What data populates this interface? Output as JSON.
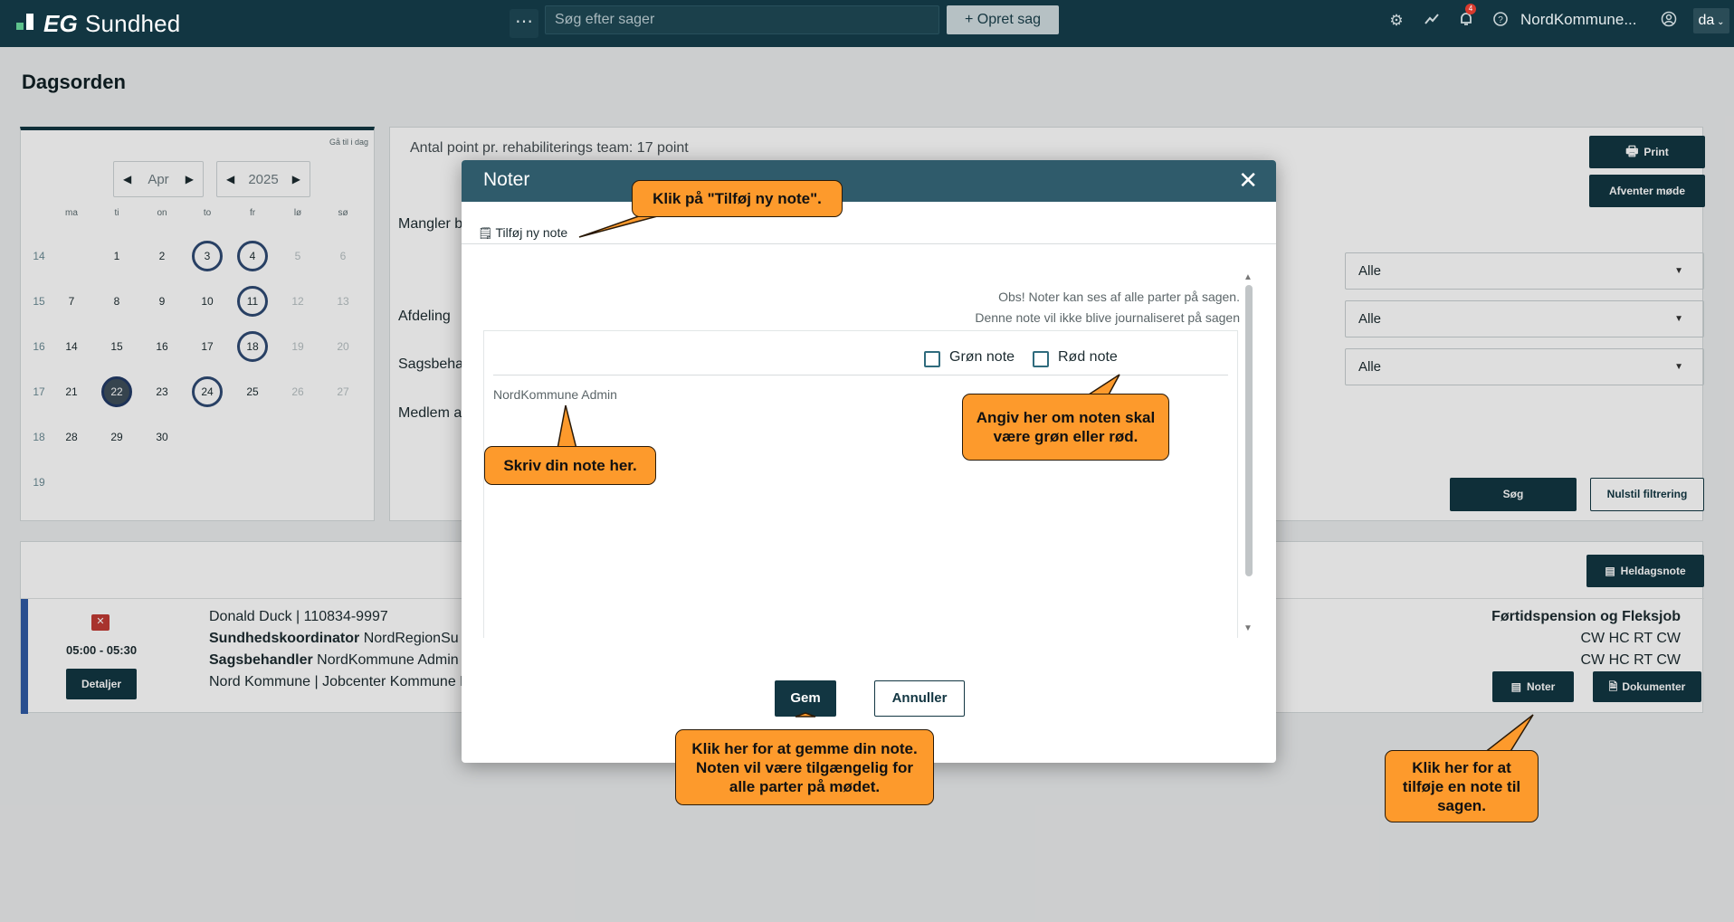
{
  "header": {
    "logo_bold": "EG",
    "logo_text": "Sundhed",
    "search_placeholder": "Søg efter sager",
    "create_label": "+ Opret sag",
    "notif_count": "4",
    "org_name": "NordKommune...",
    "lang": "da"
  },
  "page": {
    "title": "Dagsorden"
  },
  "calendar": {
    "goto_today": "Gå til i dag",
    "month": "Apr",
    "year": "2025",
    "weekdays": [
      "ma",
      "ti",
      "on",
      "to",
      "fr",
      "lø",
      "sø"
    ],
    "weeks": [
      {
        "wk": "14",
        "days": [
          "",
          "1",
          "2",
          "3",
          "4",
          "5",
          "6"
        ]
      },
      {
        "wk": "15",
        "days": [
          "7",
          "8",
          "9",
          "10",
          "11",
          "12",
          "13"
        ]
      },
      {
        "wk": "16",
        "days": [
          "14",
          "15",
          "16",
          "17",
          "18",
          "19",
          "20"
        ]
      },
      {
        "wk": "17",
        "days": [
          "21",
          "22",
          "23",
          "24",
          "25",
          "26",
          "27"
        ]
      },
      {
        "wk": "18",
        "days": [
          "28",
          "29",
          "30",
          "",
          "",
          "",
          ""
        ]
      },
      {
        "wk": "19",
        "days": [
          "",
          "",
          "",
          "",
          "",
          "",
          ""
        ]
      }
    ],
    "ringed": [
      "3",
      "4",
      "11",
      "18",
      "24"
    ],
    "today": "22"
  },
  "filters": {
    "points_text": "Antal point pr. rehabiliterings team: 17 point",
    "label_missing": "Mangler b",
    "label_department": "Afdeling",
    "label_caseworker": "Sagsbeha",
    "label_member": "Medlem a",
    "select_1": "Alle",
    "select_2": "Alle",
    "select_3": "Alle",
    "print_label": "Print",
    "await_label": "Afventer møde",
    "search_label": "Søg",
    "reset_label": "Nulstil filtrering"
  },
  "agenda": {
    "all_day_note_label": "Heldagsnote",
    "item": {
      "time": "05:00 - 05:30",
      "details_label": "Detaljer",
      "citizen": "Donald Duck | 110834-9997",
      "role1_label": "Sundhedskoordinator",
      "role1_value": "NordRegionSu",
      "role2_label": "Sagsbehandler",
      "role2_value": "NordKommune Admin",
      "location": "Nord Kommune | Jobcenter Kommune N",
      "type": "Førtidspension og Fleksjob",
      "codes1": "CW HC RT CW",
      "codes2": "CW HC RT CW",
      "notes_label": "Noter",
      "documents_label": "Dokumenter"
    }
  },
  "modal": {
    "title": "Noter",
    "add_note_label": "Tilføj ny note",
    "info_line1": "Obs! Noter kan ses af alle parter på sagen.",
    "info_line2": "Denne note vil ikke blive journaliseret på sagen",
    "green_label": "Grøn note",
    "red_label": "Rød note",
    "author": "NordKommune Admin",
    "save_label": "Gem",
    "cancel_label": "Annuller"
  },
  "callouts": {
    "add_note": "Klik på \"Tilføj ny note\".",
    "write_note": "Skriv din note her.",
    "color_note": "Angiv her om noten skal være grøn eller rød.",
    "save_note": "Klik her for at gemme din note. Noten vil være tilgængelig for alle parter på mødet.",
    "notes_button": "Klik her for at tilføje en note til sagen."
  },
  "colors": {
    "topbar": "#123642",
    "modal_header": "#2f5b6b",
    "callout": "#fd9a2c",
    "accent_bar": "#2e5aa5"
  }
}
